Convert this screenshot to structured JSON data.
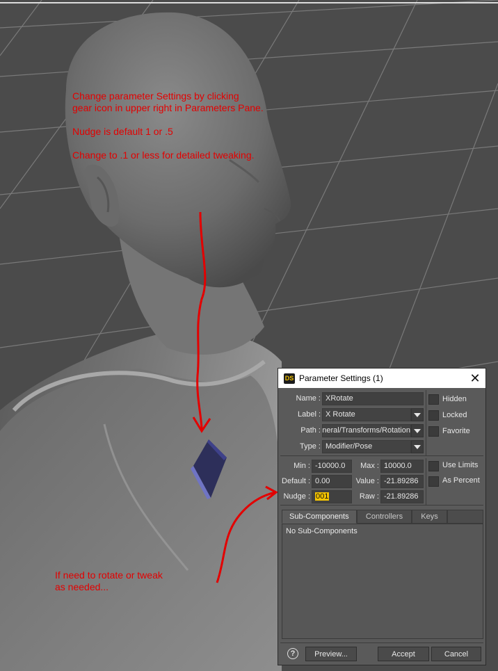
{
  "annotations": {
    "top_note": "Change parameter Settings by clicking\ngear icon in upper right in Parameters Pane.\n\nNudge is default 1 or .5\n\nChange to .1 or less for detailed tweaking.",
    "bottom_note": "If need to rotate or tweak\nas needed..."
  },
  "colors": {
    "annotation": "#e30000",
    "nudge_highlight": "#f5c400",
    "dialog_bg": "#5a5a5a"
  },
  "dialog": {
    "title": "Parameter Settings (1)",
    "logo": "DS",
    "close_icon": "close-icon",
    "fields": {
      "name_label": "Name :",
      "name_value": "XRotate",
      "label_label": "Label :",
      "label_value": "X Rotate",
      "path_label": "Path :",
      "path_value": "General/Transforms/Rotation",
      "type_label": "Type :",
      "type_value": "Modifier/Pose"
    },
    "flags": {
      "hidden": "Hidden",
      "locked": "Locked",
      "favorite": "Favorite"
    },
    "limits": {
      "min_label": "Min :",
      "min_value": "-10000.0",
      "max_label": "Max :",
      "max_value": "10000.0",
      "default_label": "Default :",
      "default_value": "0.00",
      "value_label": "Value :",
      "value_value": "-21.89286",
      "nudge_label": "Nudge :",
      "nudge_value": "001",
      "raw_label": "Raw :",
      "raw_value": "-21.89286",
      "use_limits": "Use Limits",
      "as_percent": "As Percent"
    },
    "tabs": [
      {
        "label": "Sub-Components",
        "active": true
      },
      {
        "label": "Controllers",
        "active": false
      },
      {
        "label": "Keys",
        "active": false
      }
    ],
    "panel_text": "No Sub-Components",
    "buttons": {
      "help_icon": "help-icon",
      "preview": "Preview...",
      "accept": "Accept",
      "cancel": "Cancel"
    }
  }
}
